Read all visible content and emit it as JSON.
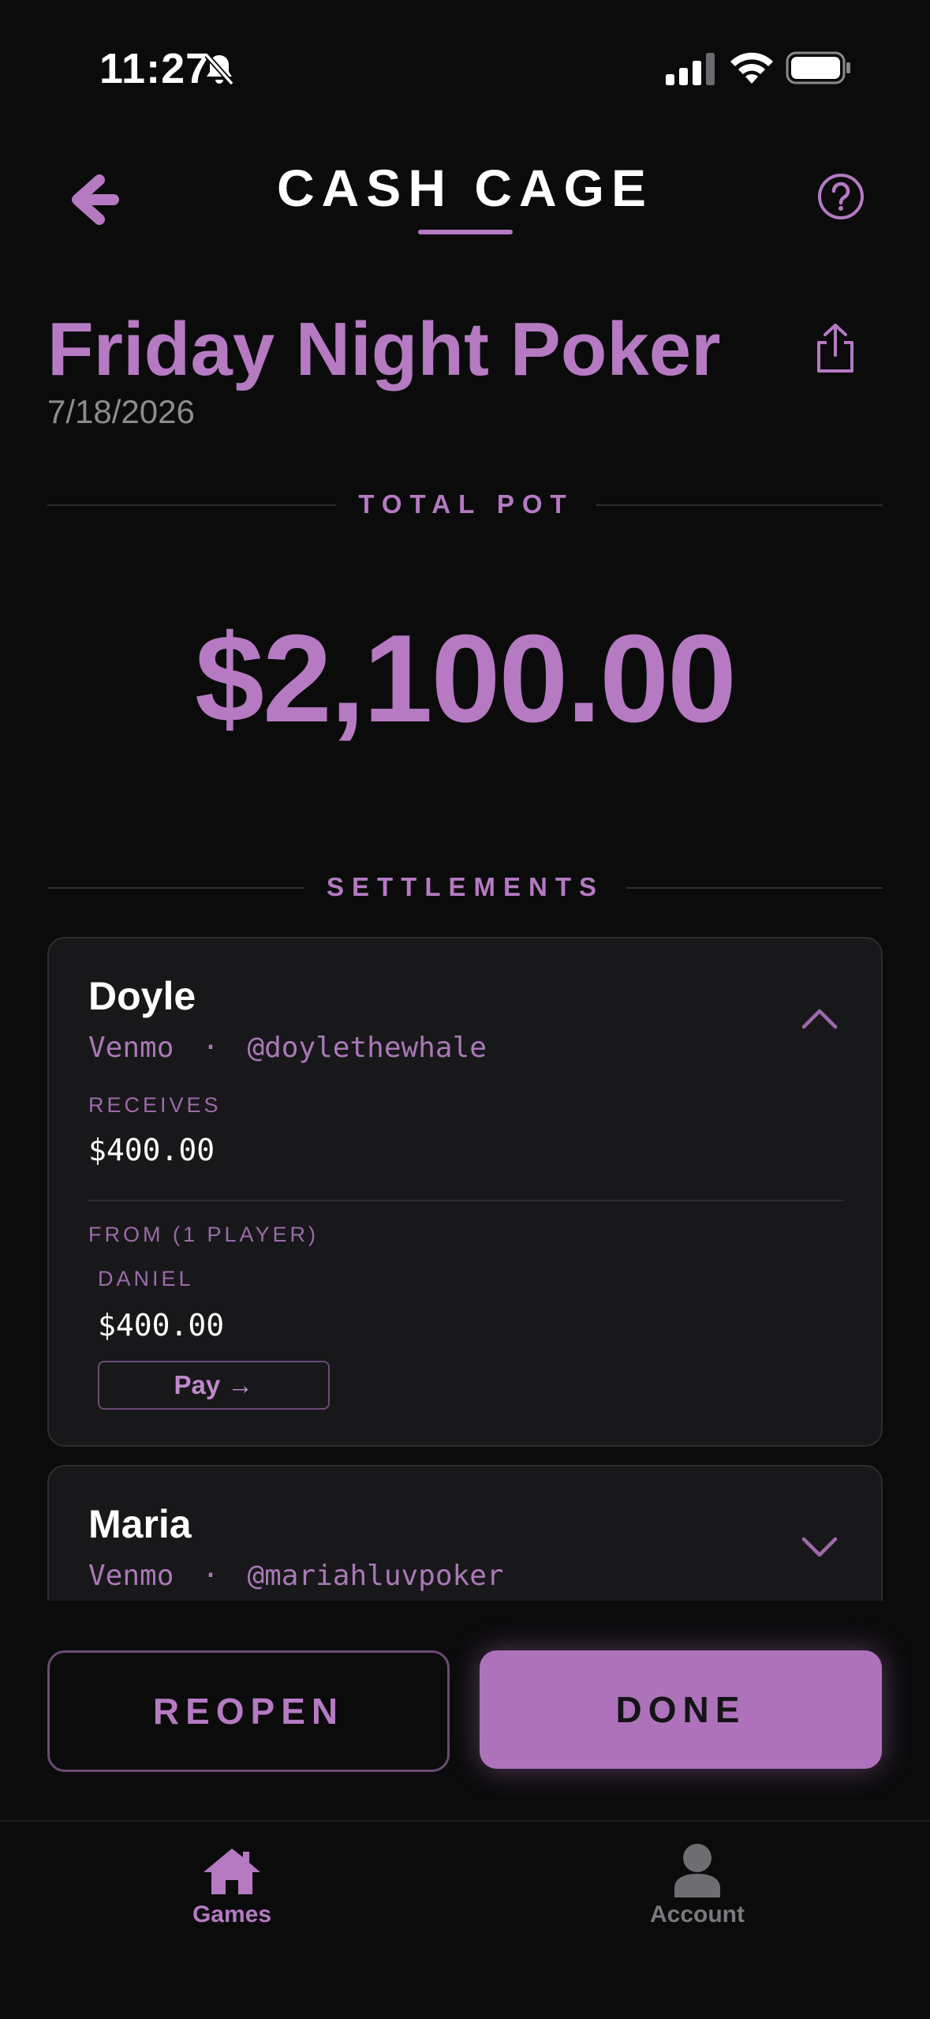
{
  "status_bar": {
    "time": "11:27"
  },
  "header": {
    "title": "CASH CAGE"
  },
  "game": {
    "title": "Friday Night Poker",
    "date": "7/18/2026"
  },
  "pot": {
    "label": "TOTAL POT",
    "amount": "$2,100.00"
  },
  "settlements": {
    "label": "SETTLEMENTS",
    "items": [
      {
        "name": "Doyle",
        "method": "Venmo",
        "separator": "·",
        "handle": "@doylethewhale",
        "receives_label": "RECEIVES",
        "receives_amount": "$400.00",
        "from_label": "FROM (1 PLAYER)",
        "payers": [
          {
            "name": "DANIEL",
            "amount": "$400.00",
            "pay_label": "Pay →"
          }
        ],
        "expanded": true
      },
      {
        "name": "Maria",
        "method": "Venmo",
        "separator": "·",
        "handle": "@mariahluvpoker",
        "expanded": false
      }
    ]
  },
  "actions": {
    "reopen_label": "REOPEN",
    "done_label": "DONE"
  },
  "tabbar": {
    "tabs": [
      {
        "label": "Games",
        "active": true
      },
      {
        "label": "Account",
        "active": false
      }
    ]
  },
  "colors": {
    "accent": "#b57ac2",
    "background": "#0b0b0c",
    "card": "#18181a",
    "inactive": "#7a7a7e"
  }
}
